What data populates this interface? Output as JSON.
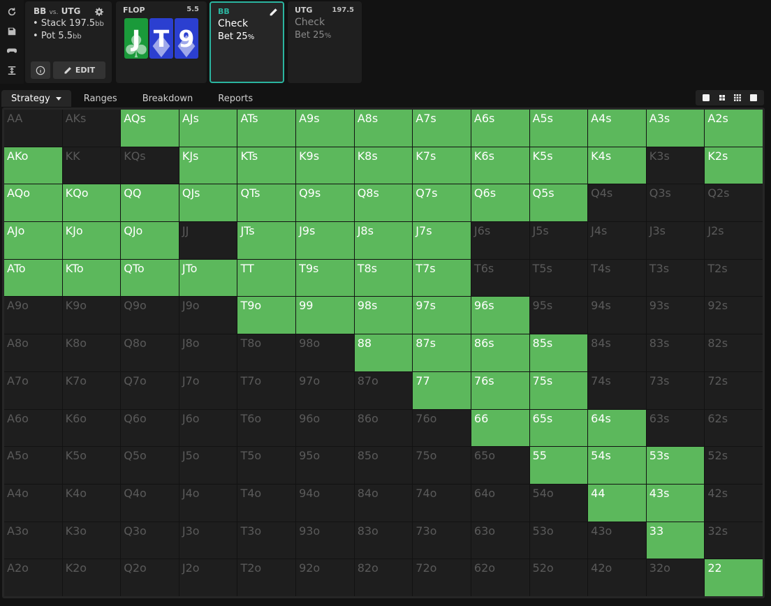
{
  "sidebar": {
    "icons": [
      "refresh-icon",
      "save-icon",
      "gamepad-icon",
      "collapse-icon"
    ]
  },
  "info_panel": {
    "hero": "BB",
    "vs": "vs.",
    "villain": "UTG",
    "stack_label": "Stack 197.5",
    "stack_unit": "bb",
    "pot_label": "Pot 5.5",
    "pot_unit": "bb",
    "edit_label": "EDIT"
  },
  "flop_panel": {
    "street": "FLOP",
    "pot": "5.5",
    "cards": [
      {
        "rank": "J",
        "suit": "♣",
        "color": "#1a9a3a"
      },
      {
        "rank": "T",
        "suit": "♦",
        "color": "#2b3fd0"
      },
      {
        "rank": "9",
        "suit": "♦",
        "color": "#2b3fd0"
      }
    ]
  },
  "bb_panel": {
    "position": "BB",
    "position_color": "#2bb5a0",
    "action1": "Check",
    "action2": "Bet 25",
    "action2_pct": "%"
  },
  "utg_panel": {
    "position": "UTG",
    "stack": "197.5",
    "action1": "Check",
    "action2": "Bet 25",
    "action2_pct": "%"
  },
  "tabs": {
    "strategy": "Strategy",
    "ranges": "Ranges",
    "breakdown": "Breakdown",
    "reports": "Reports"
  },
  "colors": {
    "in_range": "#5cb85c",
    "out_of_range": "#1e1e1e",
    "accent": "#2bb5a0"
  },
  "grid": {
    "rows": [
      [
        "AA",
        "AKs",
        "AQs",
        "AJs",
        "ATs",
        "A9s",
        "A8s",
        "A7s",
        "A6s",
        "A5s",
        "A4s",
        "A3s",
        "A2s"
      ],
      [
        "AKo",
        "KK",
        "KQs",
        "KJs",
        "KTs",
        "K9s",
        "K8s",
        "K7s",
        "K6s",
        "K5s",
        "K4s",
        "K3s",
        "K2s"
      ],
      [
        "AQo",
        "KQo",
        "QQ",
        "QJs",
        "QTs",
        "Q9s",
        "Q8s",
        "Q7s",
        "Q6s",
        "Q5s",
        "Q4s",
        "Q3s",
        "Q2s"
      ],
      [
        "AJo",
        "KJo",
        "QJo",
        "JJ",
        "JTs",
        "J9s",
        "J8s",
        "J7s",
        "J6s",
        "J5s",
        "J4s",
        "J3s",
        "J2s"
      ],
      [
        "ATo",
        "KTo",
        "QTo",
        "JTo",
        "TT",
        "T9s",
        "T8s",
        "T7s",
        "T6s",
        "T5s",
        "T4s",
        "T3s",
        "T2s"
      ],
      [
        "A9o",
        "K9o",
        "Q9o",
        "J9o",
        "T9o",
        "99",
        "98s",
        "97s",
        "96s",
        "95s",
        "94s",
        "93s",
        "92s"
      ],
      [
        "A8o",
        "K8o",
        "Q8o",
        "J8o",
        "T8o",
        "98o",
        "88",
        "87s",
        "86s",
        "85s",
        "84s",
        "83s",
        "82s"
      ],
      [
        "A7o",
        "K7o",
        "Q7o",
        "J7o",
        "T7o",
        "97o",
        "87o",
        "77",
        "76s",
        "75s",
        "74s",
        "73s",
        "72s"
      ],
      [
        "A6o",
        "K6o",
        "Q6o",
        "J6o",
        "T6o",
        "96o",
        "86o",
        "76o",
        "66",
        "65s",
        "64s",
        "63s",
        "62s"
      ],
      [
        "A5o",
        "K5o",
        "Q5o",
        "J5o",
        "T5o",
        "95o",
        "85o",
        "75o",
        "65o",
        "55",
        "54s",
        "53s",
        "52s"
      ],
      [
        "A4o",
        "K4o",
        "Q4o",
        "J4o",
        "T4o",
        "94o",
        "84o",
        "74o",
        "64o",
        "54o",
        "44",
        "43s",
        "42s"
      ],
      [
        "A3o",
        "K3o",
        "Q3o",
        "J3o",
        "T3o",
        "93o",
        "83o",
        "73o",
        "63o",
        "53o",
        "43o",
        "33",
        "32s"
      ],
      [
        "A2o",
        "K2o",
        "Q2o",
        "J2o",
        "T2o",
        "92o",
        "82o",
        "72o",
        "62o",
        "52o",
        "42o",
        "32o",
        "22"
      ]
    ],
    "in_range": [
      [
        0,
        0,
        1,
        1,
        1,
        1,
        1,
        1,
        1,
        1,
        1,
        1,
        1
      ],
      [
        1,
        0,
        0,
        1,
        1,
        1,
        1,
        1,
        1,
        1,
        1,
        0,
        1
      ],
      [
        1,
        1,
        1,
        1,
        1,
        1,
        1,
        1,
        1,
        1,
        0,
        0,
        0
      ],
      [
        1,
        1,
        1,
        0,
        1,
        1,
        1,
        1,
        0,
        0,
        0,
        0,
        0
      ],
      [
        1,
        1,
        1,
        1,
        1,
        1,
        1,
        1,
        0,
        0,
        0,
        0,
        0
      ],
      [
        0,
        0,
        0,
        0,
        1,
        1,
        1,
        1,
        1,
        0,
        0,
        0,
        0
      ],
      [
        0,
        0,
        0,
        0,
        0,
        0,
        1,
        1,
        1,
        1,
        0,
        0,
        0
      ],
      [
        0,
        0,
        0,
        0,
        0,
        0,
        0,
        1,
        1,
        1,
        0,
        0,
        0
      ],
      [
        0,
        0,
        0,
        0,
        0,
        0,
        0,
        0,
        1,
        1,
        1,
        0,
        0
      ],
      [
        0,
        0,
        0,
        0,
        0,
        0,
        0,
        0,
        0,
        1,
        1,
        1,
        0
      ],
      [
        0,
        0,
        0,
        0,
        0,
        0,
        0,
        0,
        0,
        0,
        1,
        1,
        0
      ],
      [
        0,
        0,
        0,
        0,
        0,
        0,
        0,
        0,
        0,
        0,
        0,
        1,
        0
      ],
      [
        0,
        0,
        0,
        0,
        0,
        0,
        0,
        0,
        0,
        0,
        0,
        0,
        1
      ]
    ]
  }
}
